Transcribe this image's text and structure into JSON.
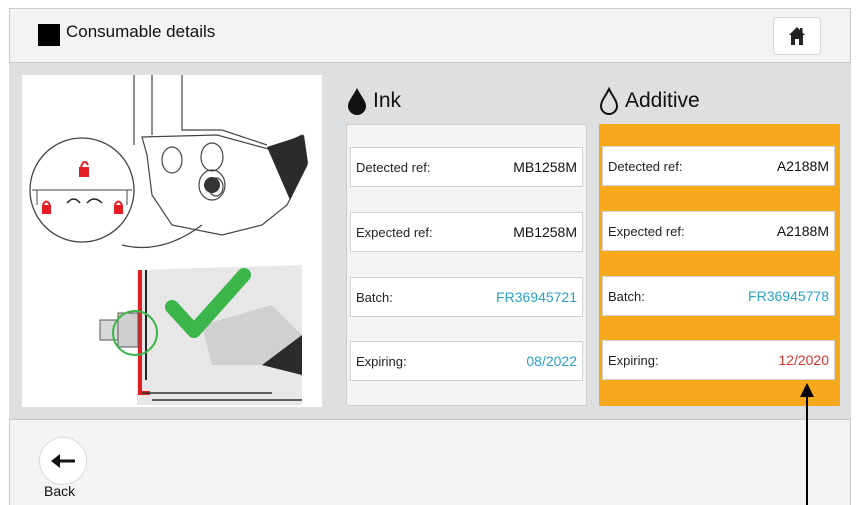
{
  "header": {
    "title": "Consumable details",
    "home_icon": "home-icon"
  },
  "illustration": {
    "description_icon": "cartridge-lock-illustration",
    "check_color": "#3cb54a",
    "lock_color": "#e31e24"
  },
  "ink": {
    "heading": "Ink",
    "icon": "drop-filled-icon",
    "fields": [
      {
        "label": "Detected ref:",
        "value": "MB1258M"
      },
      {
        "label": "Expected ref:",
        "value": "MB1258M"
      },
      {
        "label": "Batch:",
        "value": "FR36945721"
      },
      {
        "label": "Expiring:",
        "value": "08/2022"
      }
    ]
  },
  "additive": {
    "heading": "Additive",
    "icon": "drop-outline-icon",
    "highlight_color": "#f6a91a",
    "fields": [
      {
        "label": "Detected ref:",
        "value": "A2188M"
      },
      {
        "label": "Expected ref:",
        "value": "A2188M"
      },
      {
        "label": "Batch:",
        "value": "FR36945778"
      },
      {
        "label": "Expiring:",
        "value": "12/2020"
      }
    ]
  },
  "footer": {
    "back_label": "Back",
    "back_icon": "arrow-left-icon"
  },
  "colors": {
    "value_blue": "#2aa2c8",
    "expired_red": "#d8322a"
  }
}
